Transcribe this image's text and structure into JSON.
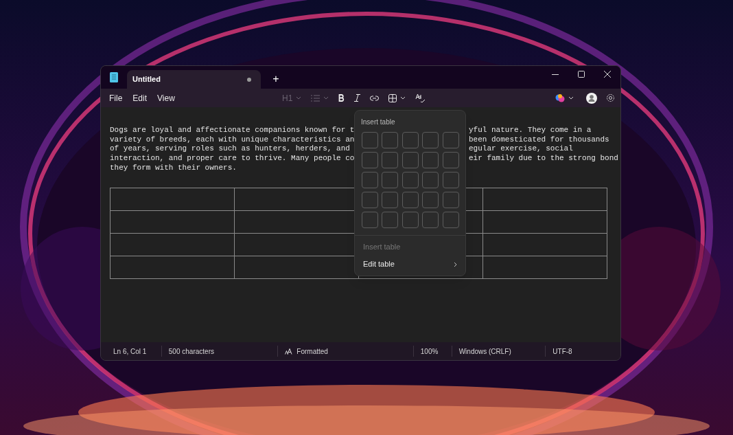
{
  "tabs": [
    {
      "label": "Untitled",
      "selected": true,
      "unsaved": true
    }
  ],
  "new_tab": "+",
  "menu": [
    "File",
    "Edit",
    "View"
  ],
  "toolbar": {
    "heading": "H1"
  },
  "document": {
    "lines": [
      {
        "left": "Dogs are loyal and affectionate companions known for t",
        "right": "yful nature. They come in a"
      },
      {
        "left": "variety of breeds, each with unique characteristics an",
        "right": "been domesticated for thousands"
      },
      {
        "left": "of years, serving roles such as hunters, herders, and",
        "right": "egular exercise, social"
      },
      {
        "left": "interaction, and proper care to thrive. Many people co",
        "right": "eir family due to the strong bond"
      },
      {
        "left": "they form with their owners."
      }
    ]
  },
  "popup": {
    "title": "Insert table",
    "items": [
      {
        "label": "Insert table",
        "disabled": true,
        "submenu": false
      },
      {
        "label": "Edit table",
        "disabled": false,
        "submenu": true
      }
    ]
  },
  "status_bar": [
    {
      "text": "Ln 6, Col 1",
      "kind": "plain"
    },
    {
      "text": "500 characters",
      "kind": "plain"
    },
    {
      "text": "Formatted",
      "kind": "format"
    },
    {
      "text": "100%",
      "kind": "plain"
    },
    {
      "text": "Windows (CRLF)",
      "kind": "plain"
    },
    {
      "text": "UTF-8",
      "kind": "plain"
    }
  ]
}
